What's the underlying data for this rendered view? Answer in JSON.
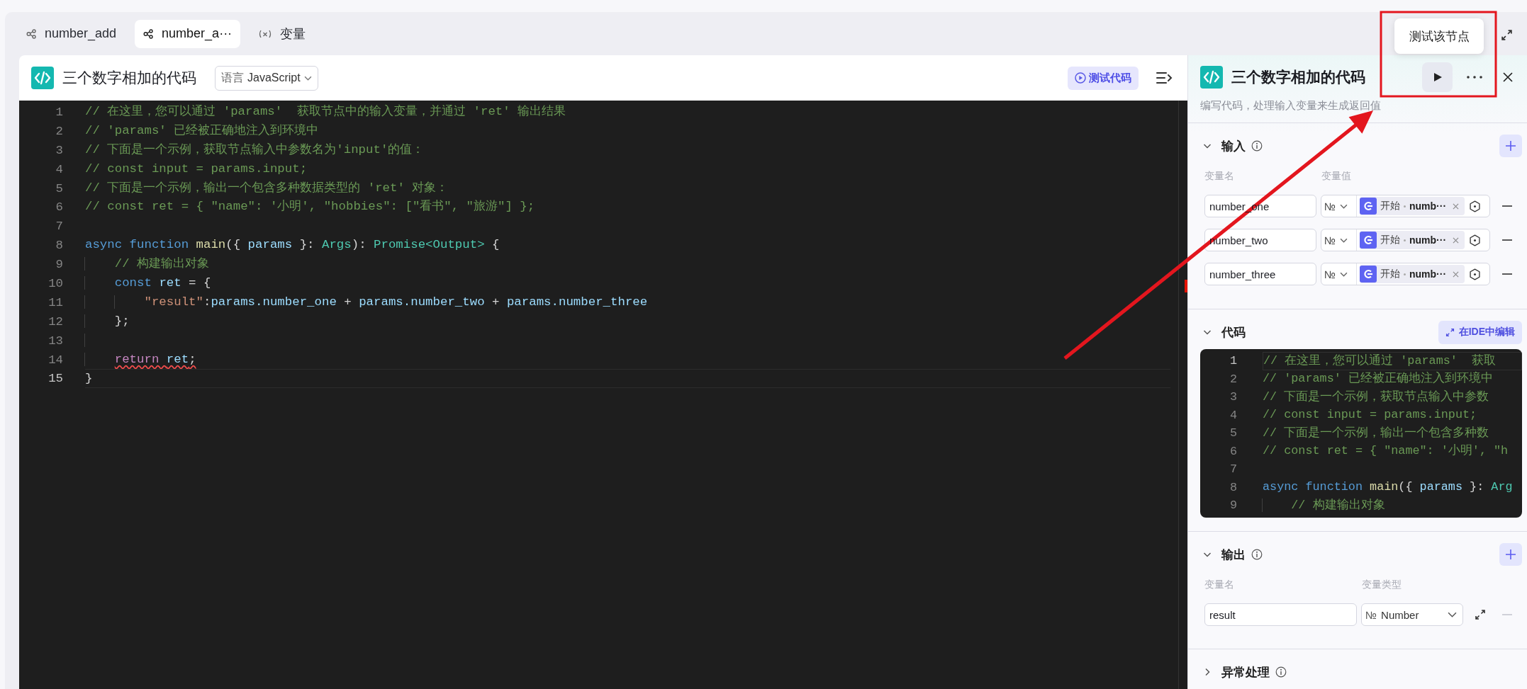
{
  "tabs": [
    {
      "label": "number_add",
      "kind": "flow",
      "selected": false
    },
    {
      "label": "number_a···",
      "kind": "flow",
      "selected": true
    },
    {
      "label": "变量",
      "kind": "variable",
      "selected": false
    }
  ],
  "editor": {
    "title": "三个数字相加的代码",
    "language_label": "语言",
    "language": "JavaScript",
    "test_button": "测试代码",
    "lines": [
      {
        "number": "1",
        "current": false,
        "error": false,
        "tokens": [
          {
            "kind": "comment",
            "text": "// 在这里，您可以通过 'params'  获取节点中的输入变量，并通过 'ret' 输出结果"
          }
        ]
      },
      {
        "number": "2",
        "current": false,
        "error": false,
        "tokens": [
          {
            "kind": "comment",
            "text": "// 'params' 已经被正确地注入到环境中"
          }
        ]
      },
      {
        "number": "3",
        "current": false,
        "error": false,
        "tokens": [
          {
            "kind": "comment",
            "text": "// 下面是一个示例，获取节点输入中参数名为'input'的值："
          }
        ]
      },
      {
        "number": "4",
        "current": false,
        "error": false,
        "tokens": [
          {
            "kind": "comment",
            "text": "// const input = params.input;"
          }
        ]
      },
      {
        "number": "5",
        "current": false,
        "error": false,
        "tokens": [
          {
            "kind": "comment",
            "text": "// 下面是一个示例，输出一个包含多种数据类型的 'ret' 对象："
          }
        ]
      },
      {
        "number": "6",
        "current": false,
        "error": false,
        "tokens": [
          {
            "kind": "comment",
            "text": "// const ret = { \"name\": '小明', \"hobbies\": [\"看书\", \"旅游\"] };"
          }
        ]
      },
      {
        "number": "7",
        "current": false
      },
      {
        "number": "8",
        "current": false,
        "error": false,
        "tokens": [
          {
            "kind": "keyword",
            "text": "async function "
          },
          {
            "kind": "function",
            "text": "main"
          },
          {
            "kind": "plain",
            "text": "({ "
          },
          {
            "kind": "variable",
            "text": "params"
          },
          {
            "kind": "plain",
            "text": " }: "
          },
          {
            "kind": "type",
            "text": "Args"
          },
          {
            "kind": "plain",
            "text": "): "
          },
          {
            "kind": "type",
            "text": "Promise<Output>"
          },
          {
            "kind": "plain",
            "text": " {"
          }
        ]
      },
      {
        "number": "9",
        "current": false,
        "error": false,
        "tokens": [
          {
            "kind": "comment",
            "text": "    // 构建输出对象"
          }
        ]
      },
      {
        "number": "10",
        "current": false,
        "error": false,
        "tokens": [
          {
            "kind": "keyword",
            "text": "    const "
          },
          {
            "kind": "variable",
            "text": "ret"
          },
          {
            "kind": "plain",
            "text": " = {"
          }
        ]
      },
      {
        "number": "11",
        "current": false,
        "error": false,
        "tokens": [
          {
            "kind": "string",
            "text": "        \"result\""
          },
          {
            "kind": "plain",
            "text": ":"
          },
          {
            "kind": "variable",
            "text": "params.number_one"
          },
          {
            "kind": "plain",
            "text": " + "
          },
          {
            "kind": "variable",
            "text": "params.number_two"
          },
          {
            "kind": "plain",
            "text": " + "
          },
          {
            "kind": "variable",
            "text": "params.number_three"
          }
        ]
      },
      {
        "number": "12",
        "current": false,
        "error": false,
        "tokens": [
          {
            "kind": "plain",
            "text": "    };"
          }
        ]
      },
      {
        "number": "13",
        "current": false
      },
      {
        "number": "14",
        "current": false,
        "error": true,
        "tokens": [
          {
            "kind": "control",
            "text": "    return "
          },
          {
            "kind": "variable",
            "text": "ret"
          },
          {
            "kind": "plain",
            "text": ";"
          }
        ]
      },
      {
        "number": "15",
        "current": true,
        "error": false,
        "tokens": [
          {
            "kind": "plain",
            "text": "}"
          }
        ]
      }
    ]
  },
  "node_panel": {
    "title": "三个数字相加的代码",
    "description": "编写代码，处理输入变量来生成返回值",
    "tooltip": "测试该节点",
    "sections": [
      {
        "kind": "inputs",
        "title": "输入",
        "expanded": true,
        "columns": [
          "变量名",
          "变量值"
        ],
        "rows": [
          {
            "name": "number_one",
            "type": "№",
            "source": "开始",
            "field": "numb···",
            "disabled": false
          },
          {
            "name": "number_two",
            "type": "№",
            "source": "开始",
            "field": "numb···",
            "disabled": false
          },
          {
            "name": "number_three",
            "type": "№",
            "source": "开始",
            "field": "numb···",
            "disabled": false
          }
        ]
      },
      {
        "kind": "code",
        "title": "代码",
        "expanded": true,
        "ide_button": "在IDE中编辑",
        "lines": [
          {
            "number": "1",
            "current": true,
            "tokens": [
              {
                "kind": "comment",
                "text": "// 在这里，您可以通过 'params'  获取"
              }
            ]
          },
          {
            "number": "2",
            "current": false,
            "tokens": [
              {
                "kind": "comment",
                "text": "// 'params' 已经被正确地注入到环境中"
              }
            ]
          },
          {
            "number": "3",
            "current": false,
            "tokens": [
              {
                "kind": "comment",
                "text": "// 下面是一个示例，获取节点输入中参数"
              }
            ]
          },
          {
            "number": "4",
            "current": false,
            "tokens": [
              {
                "kind": "comment",
                "text": "// const input = params.input;"
              }
            ]
          },
          {
            "number": "5",
            "current": false,
            "tokens": [
              {
                "kind": "comment",
                "text": "// 下面是一个示例，输出一个包含多种数"
              }
            ]
          },
          {
            "number": "6",
            "current": false,
            "tokens": [
              {
                "kind": "comment",
                "text": "// const ret = { \"name\": '小明', \"h"
              }
            ]
          },
          {
            "number": "7",
            "current": false
          },
          {
            "number": "8",
            "current": false,
            "tokens": [
              {
                "kind": "keyword",
                "text": "async function "
              },
              {
                "kind": "function",
                "text": "main"
              },
              {
                "kind": "plain",
                "text": "({ "
              },
              {
                "kind": "variable",
                "text": "params"
              },
              {
                "kind": "plain",
                "text": " }: "
              },
              {
                "kind": "type",
                "text": "Arg"
              }
            ]
          },
          {
            "number": "9",
            "current": false,
            "tokens": [
              {
                "kind": "comment",
                "text": "    // 构建输出对象"
              }
            ]
          }
        ]
      },
      {
        "kind": "outputs",
        "title": "输出",
        "expanded": true,
        "columns": [
          "变量名",
          "变量类型"
        ],
        "rows": [
          {
            "name": "result",
            "type_icon": "№",
            "type": "Number",
            "disabled": true
          }
        ]
      },
      {
        "kind": "collapsed",
        "title": "异常处理",
        "expanded": false
      }
    ]
  },
  "annotations": {
    "frame": true,
    "arrow": true
  }
}
